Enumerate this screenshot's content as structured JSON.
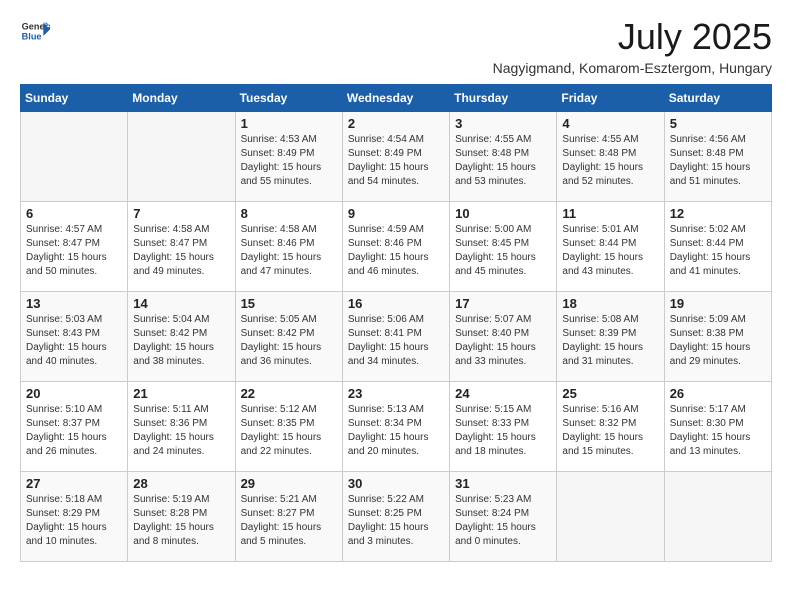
{
  "logo": {
    "general": "General",
    "blue": "Blue"
  },
  "title": {
    "month": "July 2025",
    "location": "Nagyigmand, Komarom-Esztergom, Hungary"
  },
  "weekdays": [
    "Sunday",
    "Monday",
    "Tuesday",
    "Wednesday",
    "Thursday",
    "Friday",
    "Saturday"
  ],
  "weeks": [
    [
      {
        "day": "",
        "info": ""
      },
      {
        "day": "",
        "info": ""
      },
      {
        "day": "1",
        "info": "Sunrise: 4:53 AM\nSunset: 8:49 PM\nDaylight: 15 hours\nand 55 minutes."
      },
      {
        "day": "2",
        "info": "Sunrise: 4:54 AM\nSunset: 8:49 PM\nDaylight: 15 hours\nand 54 minutes."
      },
      {
        "day": "3",
        "info": "Sunrise: 4:55 AM\nSunset: 8:48 PM\nDaylight: 15 hours\nand 53 minutes."
      },
      {
        "day": "4",
        "info": "Sunrise: 4:55 AM\nSunset: 8:48 PM\nDaylight: 15 hours\nand 52 minutes."
      },
      {
        "day": "5",
        "info": "Sunrise: 4:56 AM\nSunset: 8:48 PM\nDaylight: 15 hours\nand 51 minutes."
      }
    ],
    [
      {
        "day": "6",
        "info": "Sunrise: 4:57 AM\nSunset: 8:47 PM\nDaylight: 15 hours\nand 50 minutes."
      },
      {
        "day": "7",
        "info": "Sunrise: 4:58 AM\nSunset: 8:47 PM\nDaylight: 15 hours\nand 49 minutes."
      },
      {
        "day": "8",
        "info": "Sunrise: 4:58 AM\nSunset: 8:46 PM\nDaylight: 15 hours\nand 47 minutes."
      },
      {
        "day": "9",
        "info": "Sunrise: 4:59 AM\nSunset: 8:46 PM\nDaylight: 15 hours\nand 46 minutes."
      },
      {
        "day": "10",
        "info": "Sunrise: 5:00 AM\nSunset: 8:45 PM\nDaylight: 15 hours\nand 45 minutes."
      },
      {
        "day": "11",
        "info": "Sunrise: 5:01 AM\nSunset: 8:44 PM\nDaylight: 15 hours\nand 43 minutes."
      },
      {
        "day": "12",
        "info": "Sunrise: 5:02 AM\nSunset: 8:44 PM\nDaylight: 15 hours\nand 41 minutes."
      }
    ],
    [
      {
        "day": "13",
        "info": "Sunrise: 5:03 AM\nSunset: 8:43 PM\nDaylight: 15 hours\nand 40 minutes."
      },
      {
        "day": "14",
        "info": "Sunrise: 5:04 AM\nSunset: 8:42 PM\nDaylight: 15 hours\nand 38 minutes."
      },
      {
        "day": "15",
        "info": "Sunrise: 5:05 AM\nSunset: 8:42 PM\nDaylight: 15 hours\nand 36 minutes."
      },
      {
        "day": "16",
        "info": "Sunrise: 5:06 AM\nSunset: 8:41 PM\nDaylight: 15 hours\nand 34 minutes."
      },
      {
        "day": "17",
        "info": "Sunrise: 5:07 AM\nSunset: 8:40 PM\nDaylight: 15 hours\nand 33 minutes."
      },
      {
        "day": "18",
        "info": "Sunrise: 5:08 AM\nSunset: 8:39 PM\nDaylight: 15 hours\nand 31 minutes."
      },
      {
        "day": "19",
        "info": "Sunrise: 5:09 AM\nSunset: 8:38 PM\nDaylight: 15 hours\nand 29 minutes."
      }
    ],
    [
      {
        "day": "20",
        "info": "Sunrise: 5:10 AM\nSunset: 8:37 PM\nDaylight: 15 hours\nand 26 minutes."
      },
      {
        "day": "21",
        "info": "Sunrise: 5:11 AM\nSunset: 8:36 PM\nDaylight: 15 hours\nand 24 minutes."
      },
      {
        "day": "22",
        "info": "Sunrise: 5:12 AM\nSunset: 8:35 PM\nDaylight: 15 hours\nand 22 minutes."
      },
      {
        "day": "23",
        "info": "Sunrise: 5:13 AM\nSunset: 8:34 PM\nDaylight: 15 hours\nand 20 minutes."
      },
      {
        "day": "24",
        "info": "Sunrise: 5:15 AM\nSunset: 8:33 PM\nDaylight: 15 hours\nand 18 minutes."
      },
      {
        "day": "25",
        "info": "Sunrise: 5:16 AM\nSunset: 8:32 PM\nDaylight: 15 hours\nand 15 minutes."
      },
      {
        "day": "26",
        "info": "Sunrise: 5:17 AM\nSunset: 8:30 PM\nDaylight: 15 hours\nand 13 minutes."
      }
    ],
    [
      {
        "day": "27",
        "info": "Sunrise: 5:18 AM\nSunset: 8:29 PM\nDaylight: 15 hours\nand 10 minutes."
      },
      {
        "day": "28",
        "info": "Sunrise: 5:19 AM\nSunset: 8:28 PM\nDaylight: 15 hours\nand 8 minutes."
      },
      {
        "day": "29",
        "info": "Sunrise: 5:21 AM\nSunset: 8:27 PM\nDaylight: 15 hours\nand 5 minutes."
      },
      {
        "day": "30",
        "info": "Sunrise: 5:22 AM\nSunset: 8:25 PM\nDaylight: 15 hours\nand 3 minutes."
      },
      {
        "day": "31",
        "info": "Sunrise: 5:23 AM\nSunset: 8:24 PM\nDaylight: 15 hours\nand 0 minutes."
      },
      {
        "day": "",
        "info": ""
      },
      {
        "day": "",
        "info": ""
      }
    ]
  ]
}
